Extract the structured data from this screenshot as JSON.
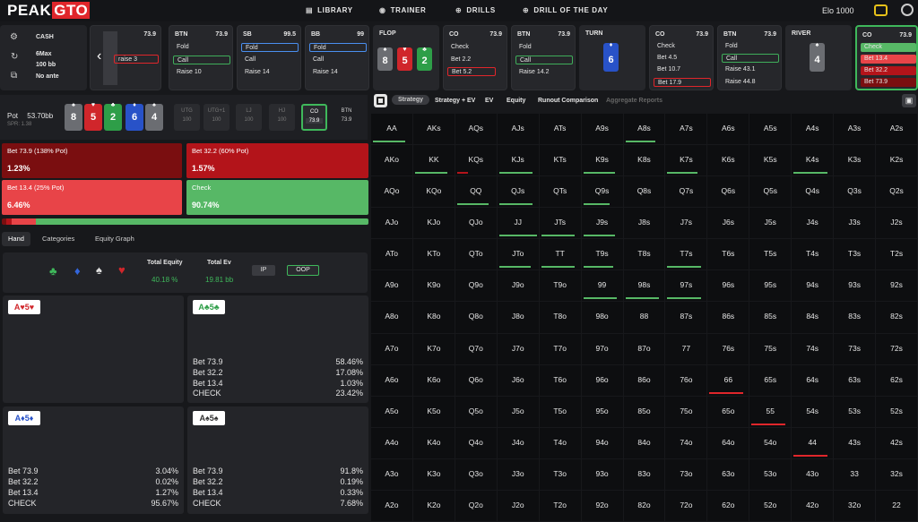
{
  "logo": {
    "peak": "PEAK",
    "gto": "GTO"
  },
  "nav": [
    {
      "label": "LIBRARY",
      "icon": "library-icon"
    },
    {
      "label": "TRAINER",
      "icon": "gamepad-icon"
    },
    {
      "label": "DRILLS",
      "icon": "target-icon"
    },
    {
      "label": "DRILL OF THE DAY",
      "icon": "plus-circle-icon"
    }
  ],
  "elo": "Elo 1000",
  "settings": {
    "game": "CASH",
    "players": "6Max",
    "stack": "100 bb",
    "ante": "No ante"
  },
  "cards": [
    {
      "pos": "",
      "stack": "73.9",
      "actions": [
        "",
        "raise 3",
        ""
      ]
    },
    {
      "pos": "BTN",
      "stack": "73.9",
      "actions": [
        "Fold",
        "Call",
        "Raise 10"
      ]
    },
    {
      "pos": "SB",
      "stack": "99.5",
      "actions": [
        "Fold",
        "Call",
        "Raise 14"
      ]
    },
    {
      "pos": "BB",
      "stack": "99",
      "actions": [
        "Fold",
        "Call",
        "Raise 14"
      ]
    },
    {
      "pos": "FLOP",
      "stack": ""
    },
    {
      "pos": "CO",
      "stack": "73.9",
      "actions": [
        "Check",
        "Bet 2.2",
        "Bet 5.2"
      ]
    },
    {
      "pos": "BTN",
      "stack": "73.9",
      "actions": [
        "Fold",
        "Call",
        "Raise 14.2"
      ]
    },
    {
      "pos": "TURN",
      "stack": ""
    },
    {
      "pos": "CO",
      "stack": "73.9",
      "actions": [
        "Check",
        "Bet 4.5",
        "Bet 10.7",
        "Bet 17.9"
      ]
    },
    {
      "pos": "BTN",
      "stack": "73.9",
      "actions": [
        "Fold",
        "Call",
        "Raise 43.1",
        "Raise 44.8"
      ]
    },
    {
      "pos": "RIVER",
      "stack": ""
    },
    {
      "pos": "CO",
      "stack": "73.9",
      "actions": [
        "Check",
        "Bet 13.4",
        "Bet 32.2",
        "Bet 73.9"
      ]
    }
  ],
  "board": {
    "flop": [
      {
        "r": "8",
        "s": "♠"
      },
      {
        "r": "5",
        "s": "♥"
      },
      {
        "r": "2",
        "s": "♣"
      }
    ],
    "turn": {
      "r": "6",
      "s": "♦"
    },
    "river": {
      "r": "4",
      "s": "♠"
    }
  },
  "pot": {
    "label": "Pot",
    "value": "53.70bb",
    "spr": "SPR: 1.38",
    "cards": [
      {
        "r": "8",
        "s": "♠"
      },
      {
        "r": "5",
        "s": "♥"
      },
      {
        "r": "2",
        "s": "♣"
      },
      {
        "r": "6",
        "s": "♦"
      },
      {
        "r": "4",
        "s": "♠"
      }
    ]
  },
  "seats": [
    {
      "p": "UTG",
      "v": "100"
    },
    {
      "p": "UTG+1",
      "v": "100"
    },
    {
      "p": "LJ",
      "v": "100"
    },
    {
      "p": "HJ",
      "v": "100"
    },
    {
      "p": "CO",
      "v": "73.9"
    },
    {
      "p": "BTN",
      "v": "73.9"
    }
  ],
  "actions": [
    {
      "label": "Bet 73.9 (138% Pot)",
      "pct": "1.23%",
      "color": "#7a0e10"
    },
    {
      "label": "Bet 32.2 (60% Pot)",
      "pct": "1.57%",
      "color": "#b3141a"
    },
    {
      "label": "Bet 13.4 (25% Pot)",
      "pct": "6.46%",
      "color": "#e84448"
    },
    {
      "label": "Check",
      "pct": "90.74%",
      "color": "#57b866"
    }
  ],
  "freqbar": [
    1.23,
    1.57,
    6.46,
    90.74
  ],
  "tabs": [
    "Hand",
    "Categories",
    "Equity Graph"
  ],
  "equity": {
    "te_label": "Total Equity",
    "te": "40.18 %",
    "ev_label": "Total Ev",
    "ev": "19.81 bb",
    "ip": "IP",
    "oop": "OOP"
  },
  "combos": [
    {
      "hand": "A♥5♥",
      "rows": []
    },
    {
      "hand": "A♣5♣",
      "rows": [
        [
          "Bet 73.9",
          "58.46%"
        ],
        [
          "Bet 32.2",
          "17.08%"
        ],
        [
          "Bet 13.4",
          "1.03%"
        ],
        [
          "CHECK",
          "23.42%"
        ]
      ]
    },
    {
      "hand": "A♦5♦",
      "rows": [
        [
          "Bet 73.9",
          "3.04%"
        ],
        [
          "Bet 32.2",
          "0.02%"
        ],
        [
          "Bet 13.4",
          "1.27%"
        ],
        [
          "CHECK",
          "95.67%"
        ]
      ]
    },
    {
      "hand": "A♠5♠",
      "rows": [
        [
          "Bet 73.9",
          "91.8%"
        ],
        [
          "Bet 32.2",
          "0.19%"
        ],
        [
          "Bet 13.4",
          "0.33%"
        ],
        [
          "CHECK",
          "7.68%"
        ]
      ]
    }
  ],
  "strat_tabs": [
    "Strategy",
    "Strategy + EV",
    "EV",
    "Equity",
    "Runout Comparison",
    "Aggregate Reports"
  ],
  "grid": [
    [
      "AA",
      "AKs",
      "AQs",
      "AJs",
      "ATs",
      "A9s",
      "A8s",
      "A7s",
      "A6s",
      "A5s",
      "A4s",
      "A3s",
      "A2s"
    ],
    [
      "AKo",
      "KK",
      "KQs",
      "KJs",
      "KTs",
      "K9s",
      "K8s",
      "K7s",
      "K6s",
      "K5s",
      "K4s",
      "K3s",
      "K2s"
    ],
    [
      "AQo",
      "KQo",
      "QQ",
      "QJs",
      "QTs",
      "Q9s",
      "Q8s",
      "Q7s",
      "Q6s",
      "Q5s",
      "Q4s",
      "Q3s",
      "Q2s"
    ],
    [
      "AJo",
      "KJo",
      "QJo",
      "JJ",
      "JTs",
      "J9s",
      "J8s",
      "J7s",
      "J6s",
      "J5s",
      "J4s",
      "J3s",
      "J2s"
    ],
    [
      "ATo",
      "KTo",
      "QTo",
      "JTo",
      "TT",
      "T9s",
      "T8s",
      "T7s",
      "T6s",
      "T5s",
      "T4s",
      "T3s",
      "T2s"
    ],
    [
      "A9o",
      "K9o",
      "Q9o",
      "J9o",
      "T9o",
      "99",
      "98s",
      "97s",
      "96s",
      "95s",
      "94s",
      "93s",
      "92s"
    ],
    [
      "A8o",
      "K8o",
      "Q8o",
      "J8o",
      "T8o",
      "98o",
      "88",
      "87s",
      "86s",
      "85s",
      "84s",
      "83s",
      "82s"
    ],
    [
      "A7o",
      "K7o",
      "Q7o",
      "J7o",
      "T7o",
      "97o",
      "87o",
      "77",
      "76s",
      "75s",
      "74s",
      "73s",
      "72s"
    ],
    [
      "A6o",
      "K6o",
      "Q6o",
      "J6o",
      "T6o",
      "96o",
      "86o",
      "76o",
      "66",
      "65s",
      "64s",
      "63s",
      "62s"
    ],
    [
      "A5o",
      "K5o",
      "Q5o",
      "J5o",
      "T5o",
      "95o",
      "85o",
      "75o",
      "65o",
      "55",
      "54s",
      "53s",
      "52s"
    ],
    [
      "A4o",
      "K4o",
      "Q4o",
      "J4o",
      "T4o",
      "94o",
      "84o",
      "74o",
      "64o",
      "54o",
      "44",
      "43s",
      "42s"
    ],
    [
      "A3o",
      "K3o",
      "Q3o",
      "J3o",
      "T3o",
      "93o",
      "83o",
      "73o",
      "63o",
      "53o",
      "43o",
      "33",
      "32s"
    ],
    [
      "A2o",
      "K2o",
      "Q2o",
      "J2o",
      "T2o",
      "92o",
      "82o",
      "72o",
      "62o",
      "52o",
      "42o",
      "32o",
      "22"
    ]
  ],
  "grid_bars": {
    "0-0": [
      "#57b866",
      0.85
    ],
    "0-6": [
      "#57b866",
      0.8
    ],
    "1-1": [
      "#57b866",
      0.85
    ],
    "1-2": [
      "#b3141a",
      0.3
    ],
    "1-3": [
      "#57b866",
      0.9
    ],
    "1-5": [
      "#57b866",
      0.85
    ],
    "1-7": [
      "#57b866",
      0.8
    ],
    "1-10": [
      "#57b866",
      0.9
    ],
    "2-2": [
      "#57b866",
      0.85
    ],
    "2-3": [
      "#57b866",
      0.9
    ],
    "2-5": [
      "#57b866",
      0.7
    ],
    "3-3": [
      "#57b866",
      1.0
    ],
    "3-4": [
      "#57b866",
      0.9
    ],
    "3-5": [
      "#57b866",
      0.85
    ],
    "4-3": [
      "#57b866",
      0.85
    ],
    "4-4": [
      "#57b866",
      0.9
    ],
    "4-5": [
      "#57b866",
      0.8
    ],
    "4-7": [
      "#57b866",
      0.9
    ],
    "5-5": [
      "#57b866",
      0.9
    ],
    "5-6": [
      "#57b866",
      0.9
    ],
    "5-7": [
      "#57b866",
      0.9
    ],
    "8-8": [
      "#e0262b",
      0.9
    ],
    "9-9": [
      "#e0262b",
      0.9
    ],
    "10-10": [
      "#e0262b",
      0.9
    ]
  }
}
